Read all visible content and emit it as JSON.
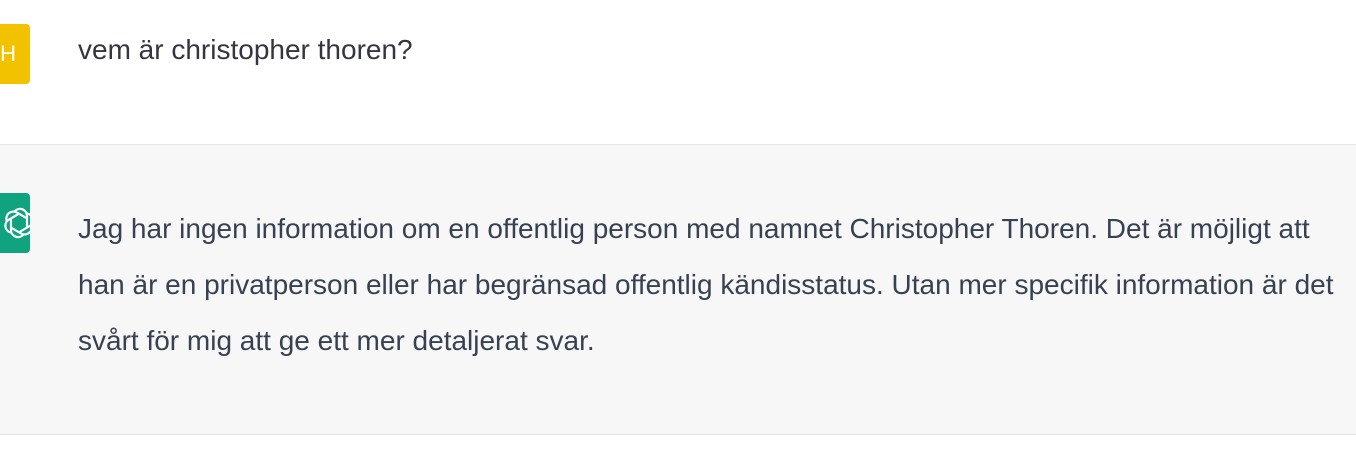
{
  "conversation": {
    "user_message": {
      "avatar_letter": "H",
      "avatar_color": "#f2c200",
      "text": "vem är christopher thoren?"
    },
    "assistant_message": {
      "avatar_icon": "openai-logo-icon",
      "avatar_color": "#10a37f",
      "text": "Jag har ingen information om en offentlig person med namnet Christopher Thoren. Det är möjligt att han är en privatperson eller har begränsad offentlig kändisstatus. Utan mer specifik information är det svårt för mig att ge ett mer detaljerat svar."
    }
  }
}
